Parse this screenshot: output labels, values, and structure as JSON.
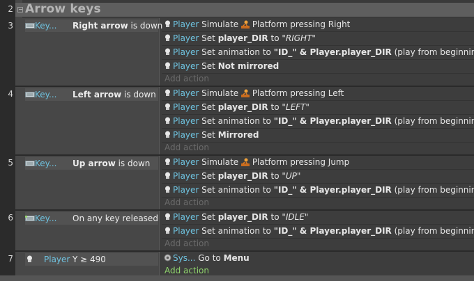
{
  "group": {
    "number": "2",
    "title": "Arrow keys"
  },
  "events": [
    {
      "number": "3",
      "cond_object": "Key...",
      "cond_key": "Right arrow",
      "cond_suffix": " is down",
      "actions": [
        {
          "obj": "Player",
          "pre": " Simulate ",
          "mid": " Platform pressing Right"
        },
        {
          "obj": "Player",
          "pre": " Set ",
          "bold": "player_DIR",
          "to": " to ",
          "val": "\"RIGHT\""
        },
        {
          "obj": "Player",
          "pre": " Set animation to ",
          "bold": "\"ID_\" & Player.player_DIR",
          "post": " (play from beginning)"
        },
        {
          "obj": "Player",
          "pre": " Set ",
          "bold": "Not mirrored"
        }
      ],
      "add": "Add action"
    },
    {
      "number": "4",
      "cond_object": "Key...",
      "cond_key": "Left arrow",
      "cond_suffix": " is down",
      "actions": [
        {
          "obj": "Player",
          "pre": " Simulate ",
          "mid": " Platform pressing Left"
        },
        {
          "obj": "Player",
          "pre": " Set ",
          "bold": "player_DIR",
          "to": " to ",
          "val": "\"LEFT\""
        },
        {
          "obj": "Player",
          "pre": " Set animation to ",
          "bold": "\"ID_\" & Player.player_DIR",
          "post": " (play from beginning)"
        },
        {
          "obj": "Player",
          "pre": " Set ",
          "bold": "Mirrored"
        }
      ],
      "add": "Add action"
    },
    {
      "number": "5",
      "cond_object": "Key...",
      "cond_key": "Up arrow",
      "cond_suffix": " is down",
      "actions": [
        {
          "obj": "Player",
          "pre": " Simulate ",
          "mid": " Platform pressing Jump"
        },
        {
          "obj": "Player",
          "pre": " Set ",
          "bold": "player_DIR",
          "to": " to ",
          "val": "\"UP\""
        },
        {
          "obj": "Player",
          "pre": " Set animation to ",
          "bold": "\"ID_\" & Player.player_DIR",
          "post": " (play from beginning)"
        }
      ],
      "add": "Add action"
    },
    {
      "number": "6",
      "cond_object": "Key...",
      "cond_key": "",
      "cond_suffix": "On any key released",
      "actions": [
        {
          "obj": "Player",
          "pre": " Set ",
          "bold": "player_DIR",
          "to": " to ",
          "val": "\"IDLE\""
        },
        {
          "obj": "Player",
          "pre": " Set animation to ",
          "bold": "\"ID_\" & Player.player_DIR",
          "post": " (play from beginning)"
        }
      ],
      "add": "Add action"
    },
    {
      "number": "7",
      "cond_object": "Player",
      "cond_key": "",
      "cond_suffix": "Y ≥ 490",
      "actions": [
        {
          "obj": "Sys...",
          "pre": "  Go to ",
          "bold": "Menu"
        }
      ],
      "add": "Add action"
    }
  ]
}
